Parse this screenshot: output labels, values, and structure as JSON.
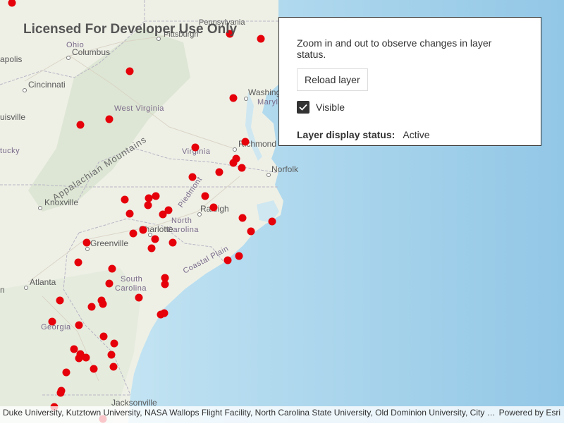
{
  "map": {
    "watermark": "Licensed For Developer Use Only",
    "places": [
      {
        "id": "pennsylvania",
        "name": "Pennsylvania"
      },
      {
        "id": "pittsburgh",
        "name": "Pittsburgh"
      },
      {
        "id": "ohio",
        "name": "Ohio"
      },
      {
        "id": "columbus",
        "name": "Columbus"
      },
      {
        "id": "indianapolis",
        "name": "apolis"
      },
      {
        "id": "cincinnati",
        "name": "Cincinnati"
      },
      {
        "id": "louisville",
        "name": "uisville"
      },
      {
        "id": "kentucky",
        "name": "tucky"
      },
      {
        "id": "west-virginia",
        "name": "West Virginia"
      },
      {
        "id": "washington",
        "name": "Washing"
      },
      {
        "id": "maryland",
        "name": "Maryla"
      },
      {
        "id": "virginia",
        "name": "Virginia"
      },
      {
        "id": "richmond",
        "name": "Richmond"
      },
      {
        "id": "norfolk",
        "name": "Norfolk"
      },
      {
        "id": "knoxville",
        "name": "Knoxville"
      },
      {
        "id": "raleigh",
        "name": "Raleigh"
      },
      {
        "id": "north-carolina",
        "name": "North\nCarolina"
      },
      {
        "id": "charlotte",
        "name": "Charlotte"
      },
      {
        "id": "greenville",
        "name": "Greenville"
      },
      {
        "id": "south-carolina",
        "name": "South\nCarolina"
      },
      {
        "id": "atlanta",
        "name": "Atlanta"
      },
      {
        "id": "georgia",
        "name": "Georgia"
      },
      {
        "id": "jacksonville",
        "name": "Jacksonville"
      },
      {
        "id": "appalachian",
        "name": "Appalachian Mountains"
      },
      {
        "id": "piedmont",
        "name": "Piedmont"
      },
      {
        "id": "coastal-plain",
        "name": "Coastal Plain"
      },
      {
        "id": "m-edge",
        "name": "n"
      }
    ]
  },
  "panel": {
    "instructions": "Zoom in and out to observe changes in layer status.",
    "reload_label": "Reload layer",
    "visible_label": "Visible",
    "visible_checked": true,
    "status_label": "Layer display status:",
    "status_value": "Active"
  },
  "attribution": {
    "text": "Duke University, Kutztown University, NASA Wallops Flight Facility, North Carolina State University, Old Dominion University, City o...",
    "powered_by": "Powered by Esri"
  },
  "colors": {
    "marker": "#e5000a",
    "land": "#eef0e8",
    "ocean": "#a8d4ec"
  }
}
